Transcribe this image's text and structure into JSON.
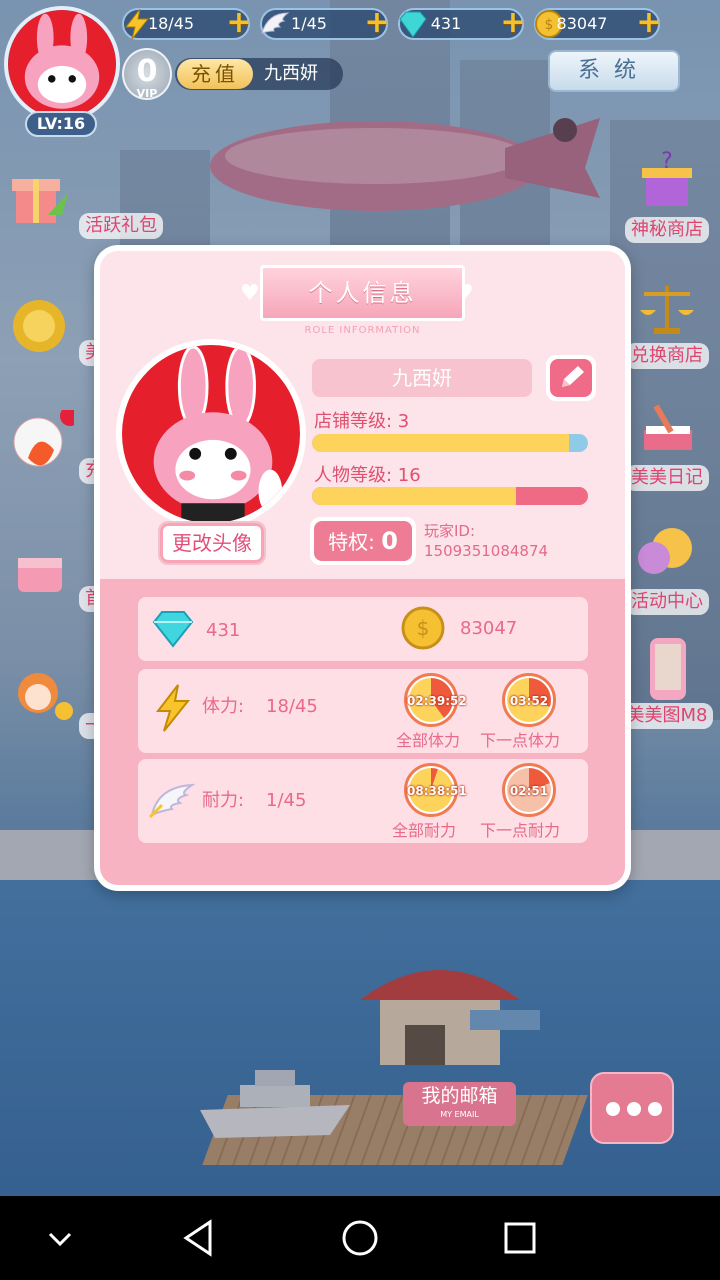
{
  "hud": {
    "level": "LV:16",
    "stamina": "18/45",
    "endurance": "1/45",
    "diamonds": "431",
    "coins": "83047",
    "vip": "0",
    "vip_label": "VIP",
    "recharge": "充值",
    "player_name": "九西妍",
    "system": "系统"
  },
  "side_left": [
    "活跃礼包",
    "美美有礼",
    "充",
    "首充礼包",
    "一元购"
  ],
  "side_right": [
    "神秘商店",
    "兑换商店",
    "美美日记",
    "活动中心",
    "美美图M8"
  ],
  "mailbox": {
    "label": "我的邮箱",
    "sub": "MY EMAIL"
  },
  "dialog": {
    "title": "个人信息",
    "subtitle": "ROLE INFORMATION",
    "name": "九西妍",
    "change_avatar": "更改头像",
    "shop_level_label": "店铺等级: 3",
    "shop_level_progress": 0.93,
    "char_level_label": "人物等级: 16",
    "char_level_progress": 0.74,
    "privilege_label": "特权:",
    "privilege_value": "0",
    "player_id_label": "玩家ID:",
    "player_id": "1509351084874",
    "diamonds": "431",
    "coins": "83047",
    "stamina_label": "体力:",
    "stamina_value": "18/45",
    "stamina_all_time": "02:39:52",
    "stamina_all_label": "全部体力",
    "stamina_next_time": "03:52",
    "stamina_next_label": "下一点体力",
    "endurance_label": "耐力:",
    "endurance_value": "1/45",
    "endurance_all_time": "08:38:51",
    "endurance_all_label": "全部耐力",
    "endurance_next_time": "02:51",
    "endurance_next_label": "下一点耐力"
  },
  "colors": {
    "accent": "#ef6b88",
    "panel": "#fde4ea",
    "bar_fill": "#fdd35c"
  }
}
